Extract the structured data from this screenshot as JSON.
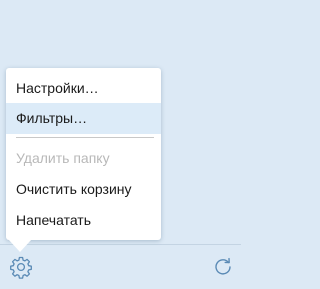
{
  "menu": {
    "items": [
      {
        "label": "Настройки…",
        "state": "normal"
      },
      {
        "label": "Фильтры…",
        "state": "highlighted"
      },
      {
        "label": "Удалить папку",
        "state": "disabled"
      },
      {
        "label": "Очистить корзину",
        "state": "normal"
      },
      {
        "label": "Напечатать",
        "state": "normal"
      }
    ]
  },
  "toolbar": {
    "left_icon": "gear-icon",
    "right_icon": "refresh-icon"
  },
  "colors": {
    "background": "#dce9f5",
    "highlight": "#dcebf8",
    "icon": "#5a8ab5",
    "disabled_text": "#b8b8b8"
  }
}
